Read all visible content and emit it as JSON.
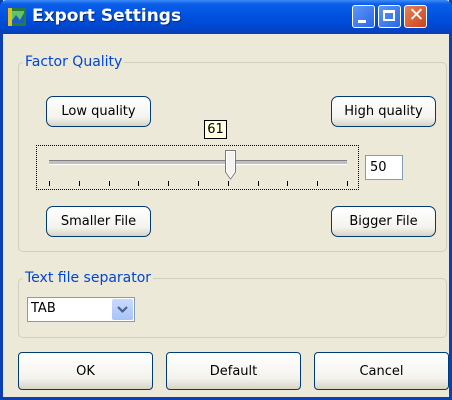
{
  "window": {
    "title": "Export Settings",
    "icon": "app-icon"
  },
  "titlebar_buttons": {
    "minimize": "minimize-icon",
    "maximize": "maximize-icon",
    "close": "close-icon"
  },
  "factor_quality": {
    "legend": "Factor Quality",
    "low_quality_label": "Low quality",
    "high_quality_label": "High quality",
    "slider_tooltip": "61",
    "slider_position": 0.61,
    "value": "50",
    "smaller_file_label": "Smaller File",
    "bigger_file_label": "Bigger File"
  },
  "text_separator": {
    "legend": "Text file separator",
    "selected": "TAB"
  },
  "buttons": {
    "ok": "OK",
    "default": "Default",
    "cancel": "Cancel"
  },
  "colors": {
    "title_bar": "#0053e0",
    "legend_text": "#0046d5",
    "dialog_bg": "#ece9d8",
    "close_button": "#c9441c"
  }
}
